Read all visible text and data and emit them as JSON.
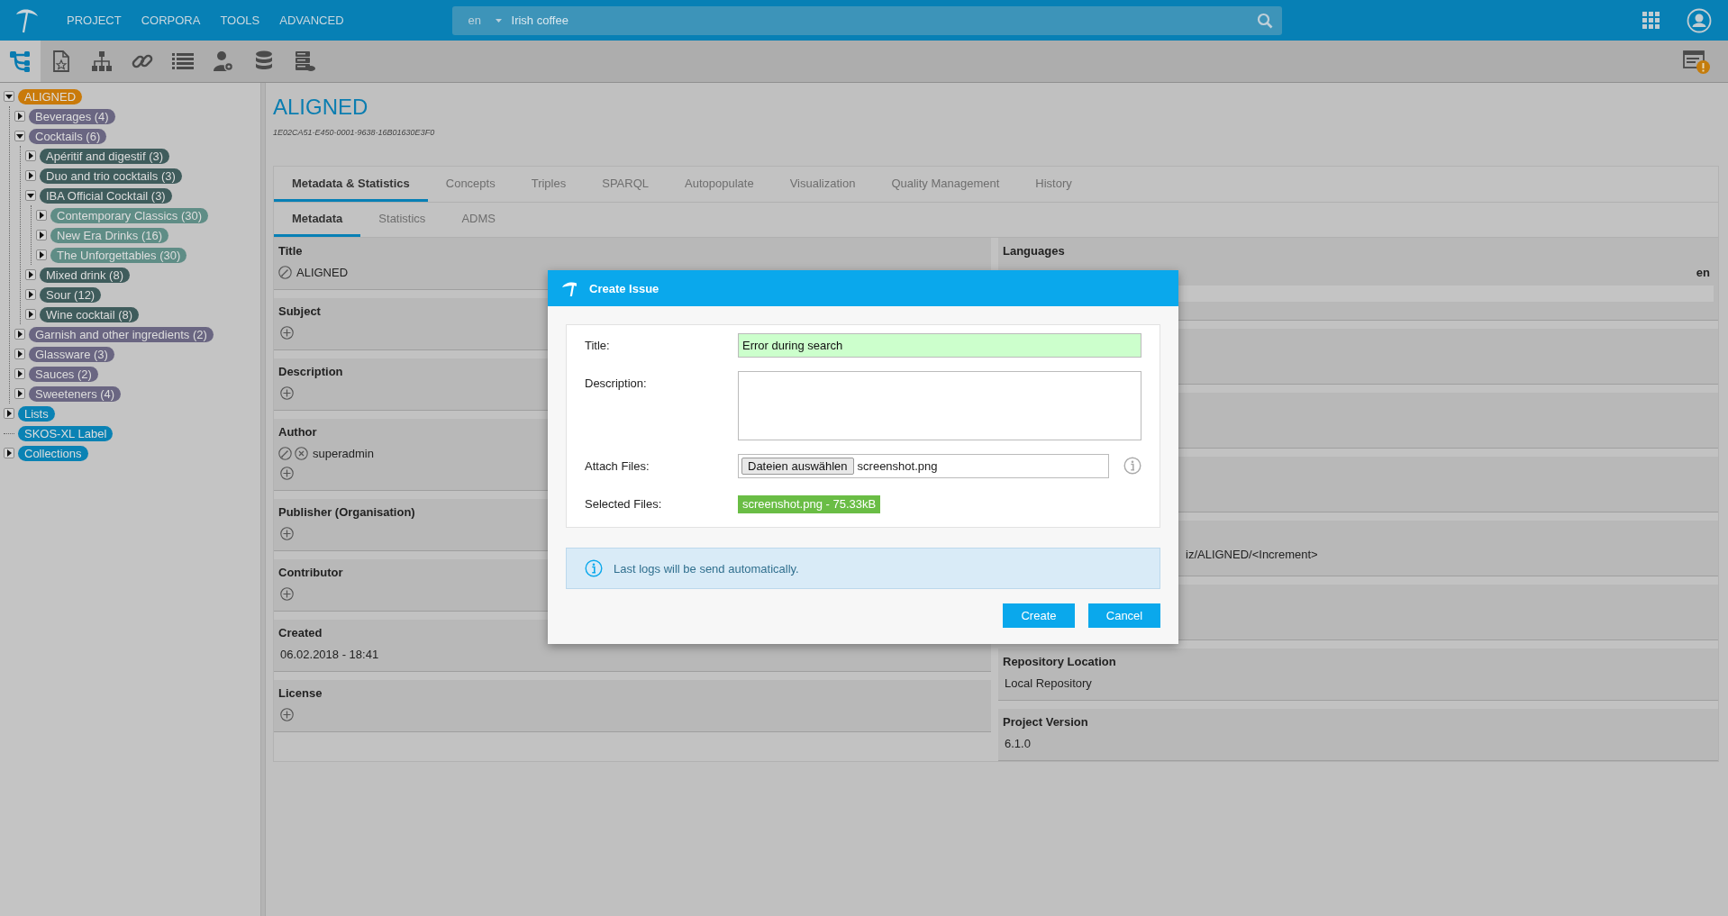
{
  "header": {
    "nav": [
      "PROJECT",
      "CORPORA",
      "TOOLS",
      "ADVANCED"
    ],
    "search": {
      "language": "en",
      "value": "Irish coffee"
    }
  },
  "toolbar": [
    {
      "kind": "tree",
      "selected": true
    },
    {
      "kind": "document",
      "selected": false
    },
    {
      "kind": "hierarchy",
      "selected": false
    },
    {
      "kind": "link",
      "selected": false
    },
    {
      "kind": "list",
      "selected": false
    },
    {
      "kind": "user-settings",
      "selected": false
    },
    {
      "kind": "database",
      "selected": false
    },
    {
      "kind": "server",
      "selected": false
    }
  ],
  "tree": [
    {
      "label": "ALIGNED",
      "color": "#c97a0a",
      "expandable": true,
      "expanded": true,
      "children": [
        {
          "label": "Beverages (4)",
          "color": "#6a6682",
          "expandable": true,
          "expanded": false
        },
        {
          "label": "Cocktails (6)",
          "color": "#6a6682",
          "expandable": true,
          "expanded": true,
          "children": [
            {
              "label": "Apéritif and digestif (3)",
              "color": "#3f5c5c",
              "expandable": true,
              "expanded": false
            },
            {
              "label": "Duo and trio cocktails (3)",
              "color": "#3f5c5c",
              "expandable": true,
              "expanded": false
            },
            {
              "label": "IBA Official Cocktail (3)",
              "color": "#3f5c5c",
              "expandable": true,
              "expanded": true,
              "children": [
                {
                  "label": "Contemporary Classics (30)",
                  "color": "#5f8d86",
                  "expandable": true,
                  "expanded": false
                },
                {
                  "label": "New Era Drinks (16)",
                  "color": "#5f8d86",
                  "expandable": true,
                  "expanded": false
                },
                {
                  "label": "The Unforgettables (30)",
                  "color": "#5f8d86",
                  "expandable": true,
                  "expanded": false
                }
              ]
            },
            {
              "label": "Mixed drink (8)",
              "color": "#3f5c5c",
              "expandable": true,
              "expanded": false
            },
            {
              "label": "Sour (12)",
              "color": "#3f5c5c",
              "expandable": true,
              "expanded": false
            },
            {
              "label": "Wine cocktail (8)",
              "color": "#3f5c5c",
              "expandable": true,
              "expanded": false
            }
          ]
        },
        {
          "label": "Garnish and other ingredients (2)",
          "color": "#6a6682",
          "expandable": true,
          "expanded": false
        },
        {
          "label": "Glassware (3)",
          "color": "#6a6682",
          "expandable": true,
          "expanded": false
        },
        {
          "label": "Sauces (2)",
          "color": "#6a6682",
          "expandable": true,
          "expanded": false
        },
        {
          "label": "Sweeteners (4)",
          "color": "#6a6682",
          "expandable": true,
          "expanded": false
        }
      ]
    },
    {
      "label": "Lists",
      "color": "#0a82b4",
      "expandable": true,
      "expanded": false
    },
    {
      "label": "SKOS-XL Label",
      "color": "#0a82b4",
      "expandable": false
    },
    {
      "label": "Collections",
      "color": "#0a82b4",
      "expandable": true,
      "expanded": false
    }
  ],
  "concept": {
    "title": "ALIGNED",
    "id": "1E02CA51-E450-0001-9638-16B01630E3F0"
  },
  "tabs": [
    {
      "label": "Metadata & Statistics",
      "selected": true
    },
    {
      "label": "Concepts",
      "selected": false
    },
    {
      "label": "Triples",
      "selected": false
    },
    {
      "label": "SPARQL",
      "selected": false
    },
    {
      "label": "Autopopulate",
      "selected": false
    },
    {
      "label": "Visualization",
      "selected": false
    },
    {
      "label": "Quality Management",
      "selected": false
    },
    {
      "label": "History",
      "selected": false
    }
  ],
  "subtabs": [
    {
      "label": "Metadata",
      "selected": true
    },
    {
      "label": "Statistics",
      "selected": false
    },
    {
      "label": "ADMS",
      "selected": false
    }
  ],
  "left_sections": [
    {
      "label": "Title",
      "values": [
        {
          "text": "ALIGNED",
          "editable": true,
          "removable": false
        }
      ],
      "addable": false
    },
    {
      "label": "Subject",
      "addable": true
    },
    {
      "label": "Description",
      "addable": true
    },
    {
      "label": "Author",
      "values": [
        {
          "text": "superadmin",
          "editable": true,
          "removable": true
        }
      ],
      "addable": true
    },
    {
      "label": "Publisher (Organisation)",
      "addable": true
    },
    {
      "label": "Contributor",
      "addable": true
    },
    {
      "label": "Created",
      "values": [
        {
          "text": "06.02.2018 - 18:41",
          "editable": false,
          "removable": false
        }
      ],
      "addable": false
    },
    {
      "label": "License",
      "addable": true
    }
  ],
  "right_sections": [
    {
      "kind": "languages",
      "label": "Languages",
      "language": "en"
    },
    {
      "kind": "covered"
    },
    {
      "kind": "covered"
    },
    {
      "kind": "covered"
    },
    {
      "kind": "covered",
      "value": "iz/ALIGNED/<Increment>"
    },
    {
      "kind": "covered"
    },
    {
      "kind": "field",
      "label": "Repository Location",
      "value": "Local Repository"
    },
    {
      "kind": "field",
      "label": "Project Version",
      "value": "6.1.0"
    }
  ],
  "dialog": {
    "title": "Create Issue",
    "fields": [
      {
        "kind": "text",
        "label": "Title:",
        "value": "Error during search"
      },
      {
        "kind": "textarea",
        "label": "Description:"
      },
      {
        "kind": "file",
        "label": "Attach Files:",
        "button": "Dateien auswählen",
        "value": "screenshot.png"
      },
      {
        "kind": "files",
        "label": "Selected Files:",
        "files": [
          "screenshot.png - 75.33kB"
        ]
      }
    ],
    "notice": "Last logs will be send automatically.",
    "buttons": [
      "Create",
      "Cancel"
    ]
  }
}
